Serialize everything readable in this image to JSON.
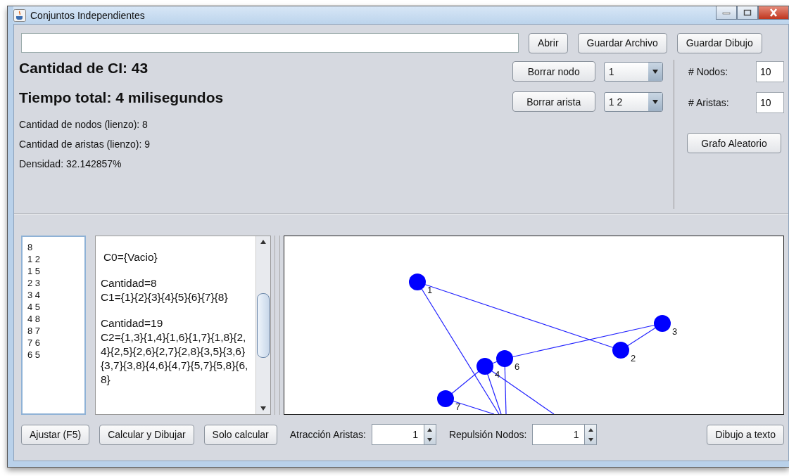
{
  "window": {
    "title": "Conjuntos Independientes"
  },
  "file_buttons": [
    "Abrir",
    "Guardar Archivo",
    "Guardar Dibujo"
  ],
  "results": {
    "ci_count": "Cantidad de CI: 43",
    "total_time": "Tiempo total: 4 milisegundos",
    "stats": [
      "Cantidad de nodos (lienzo): 8",
      "Cantidad de aristas (lienzo): 9",
      "Densidad: 32.142857%"
    ]
  },
  "delete_controls": [
    {
      "button": "Borrar nodo",
      "selection": "1"
    },
    {
      "button": "Borrar arista",
      "selection": "1 2"
    }
  ],
  "random_graph": {
    "fields": [
      {
        "label": "# Nodos:",
        "value": "10"
      },
      {
        "label": "# Aristas:",
        "value": "10"
      }
    ],
    "button": "Grafo Aleatorio"
  },
  "edge_list": [
    "8",
    "1 2",
    "1 5",
    "2 3",
    "3 4",
    "4 5",
    "4 8",
    "8 7",
    "7 6",
    "6 5"
  ],
  "output_blocks": [
    [
      "C0={Vacio}"
    ],
    [
      "Cantidad=8",
      "C1={1}{2}{3}{4}{5}{6}{7}{8}"
    ],
    [
      "Cantidad=19",
      "C2={1,3}{1,4}{1,6}{1,7}{1,8}{2,4}{2,5}{2,6}{2,7}{2,8}{3,5}{3,6}{3,7}{3,8}{4,6}{4,7}{5,7}{5,8}{6,8}"
    ]
  ],
  "graph": {
    "nodes": [
      {
        "label": "1"
      },
      {
        "label": "3"
      },
      {
        "label": "2"
      },
      {
        "label": "6"
      },
      {
        "label": "4"
      },
      {
        "label": "7"
      }
    ]
  },
  "bottom_buttons": [
    "Ajustar (F5)",
    "Calcular y Dibujar",
    "Solo calcular"
  ],
  "spinners": [
    {
      "label": "Atracción Aristas:",
      "value": "1"
    },
    {
      "label": "Repulsión Nodos:",
      "value": "1"
    }
  ],
  "text_button": "Dibujo a texto"
}
